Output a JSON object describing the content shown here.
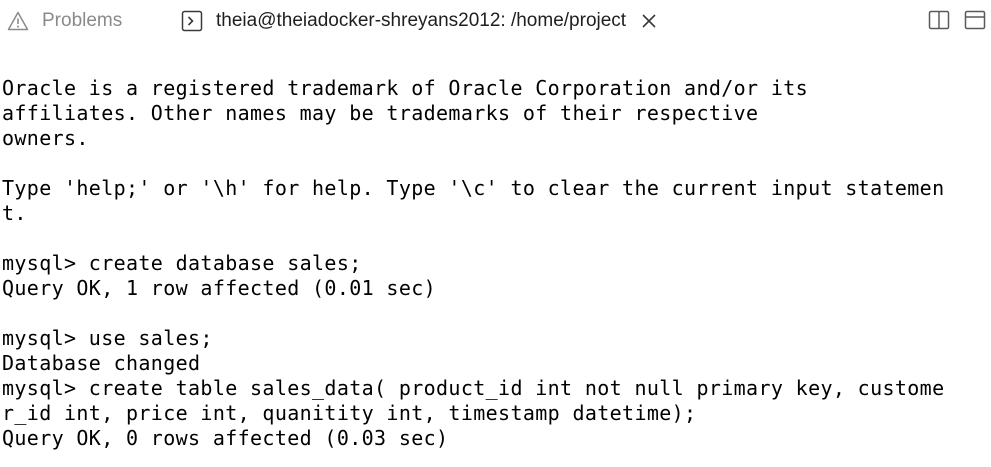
{
  "tabs": {
    "problems_label": "Problems",
    "terminal_label": "theia@theiadocker-shreyans2012: /home/project"
  },
  "terminal_lines": [
    "Oracle is a registered trademark of Oracle Corporation and/or its",
    "affiliates. Other names may be trademarks of their respective",
    "owners.",
    "",
    "Type 'help;' or '\\h' for help. Type '\\c' to clear the current input statemen",
    "t.",
    "",
    "mysql> create database sales;",
    "Query OK, 1 row affected (0.01 sec)",
    "",
    "mysql> use sales;",
    "Database changed",
    "mysql> create table sales_data( product_id int not null primary key, custome",
    "r_id int, price int, quanitity int, timestamp datetime);",
    "Query OK, 0 rows affected (0.03 sec)"
  ]
}
